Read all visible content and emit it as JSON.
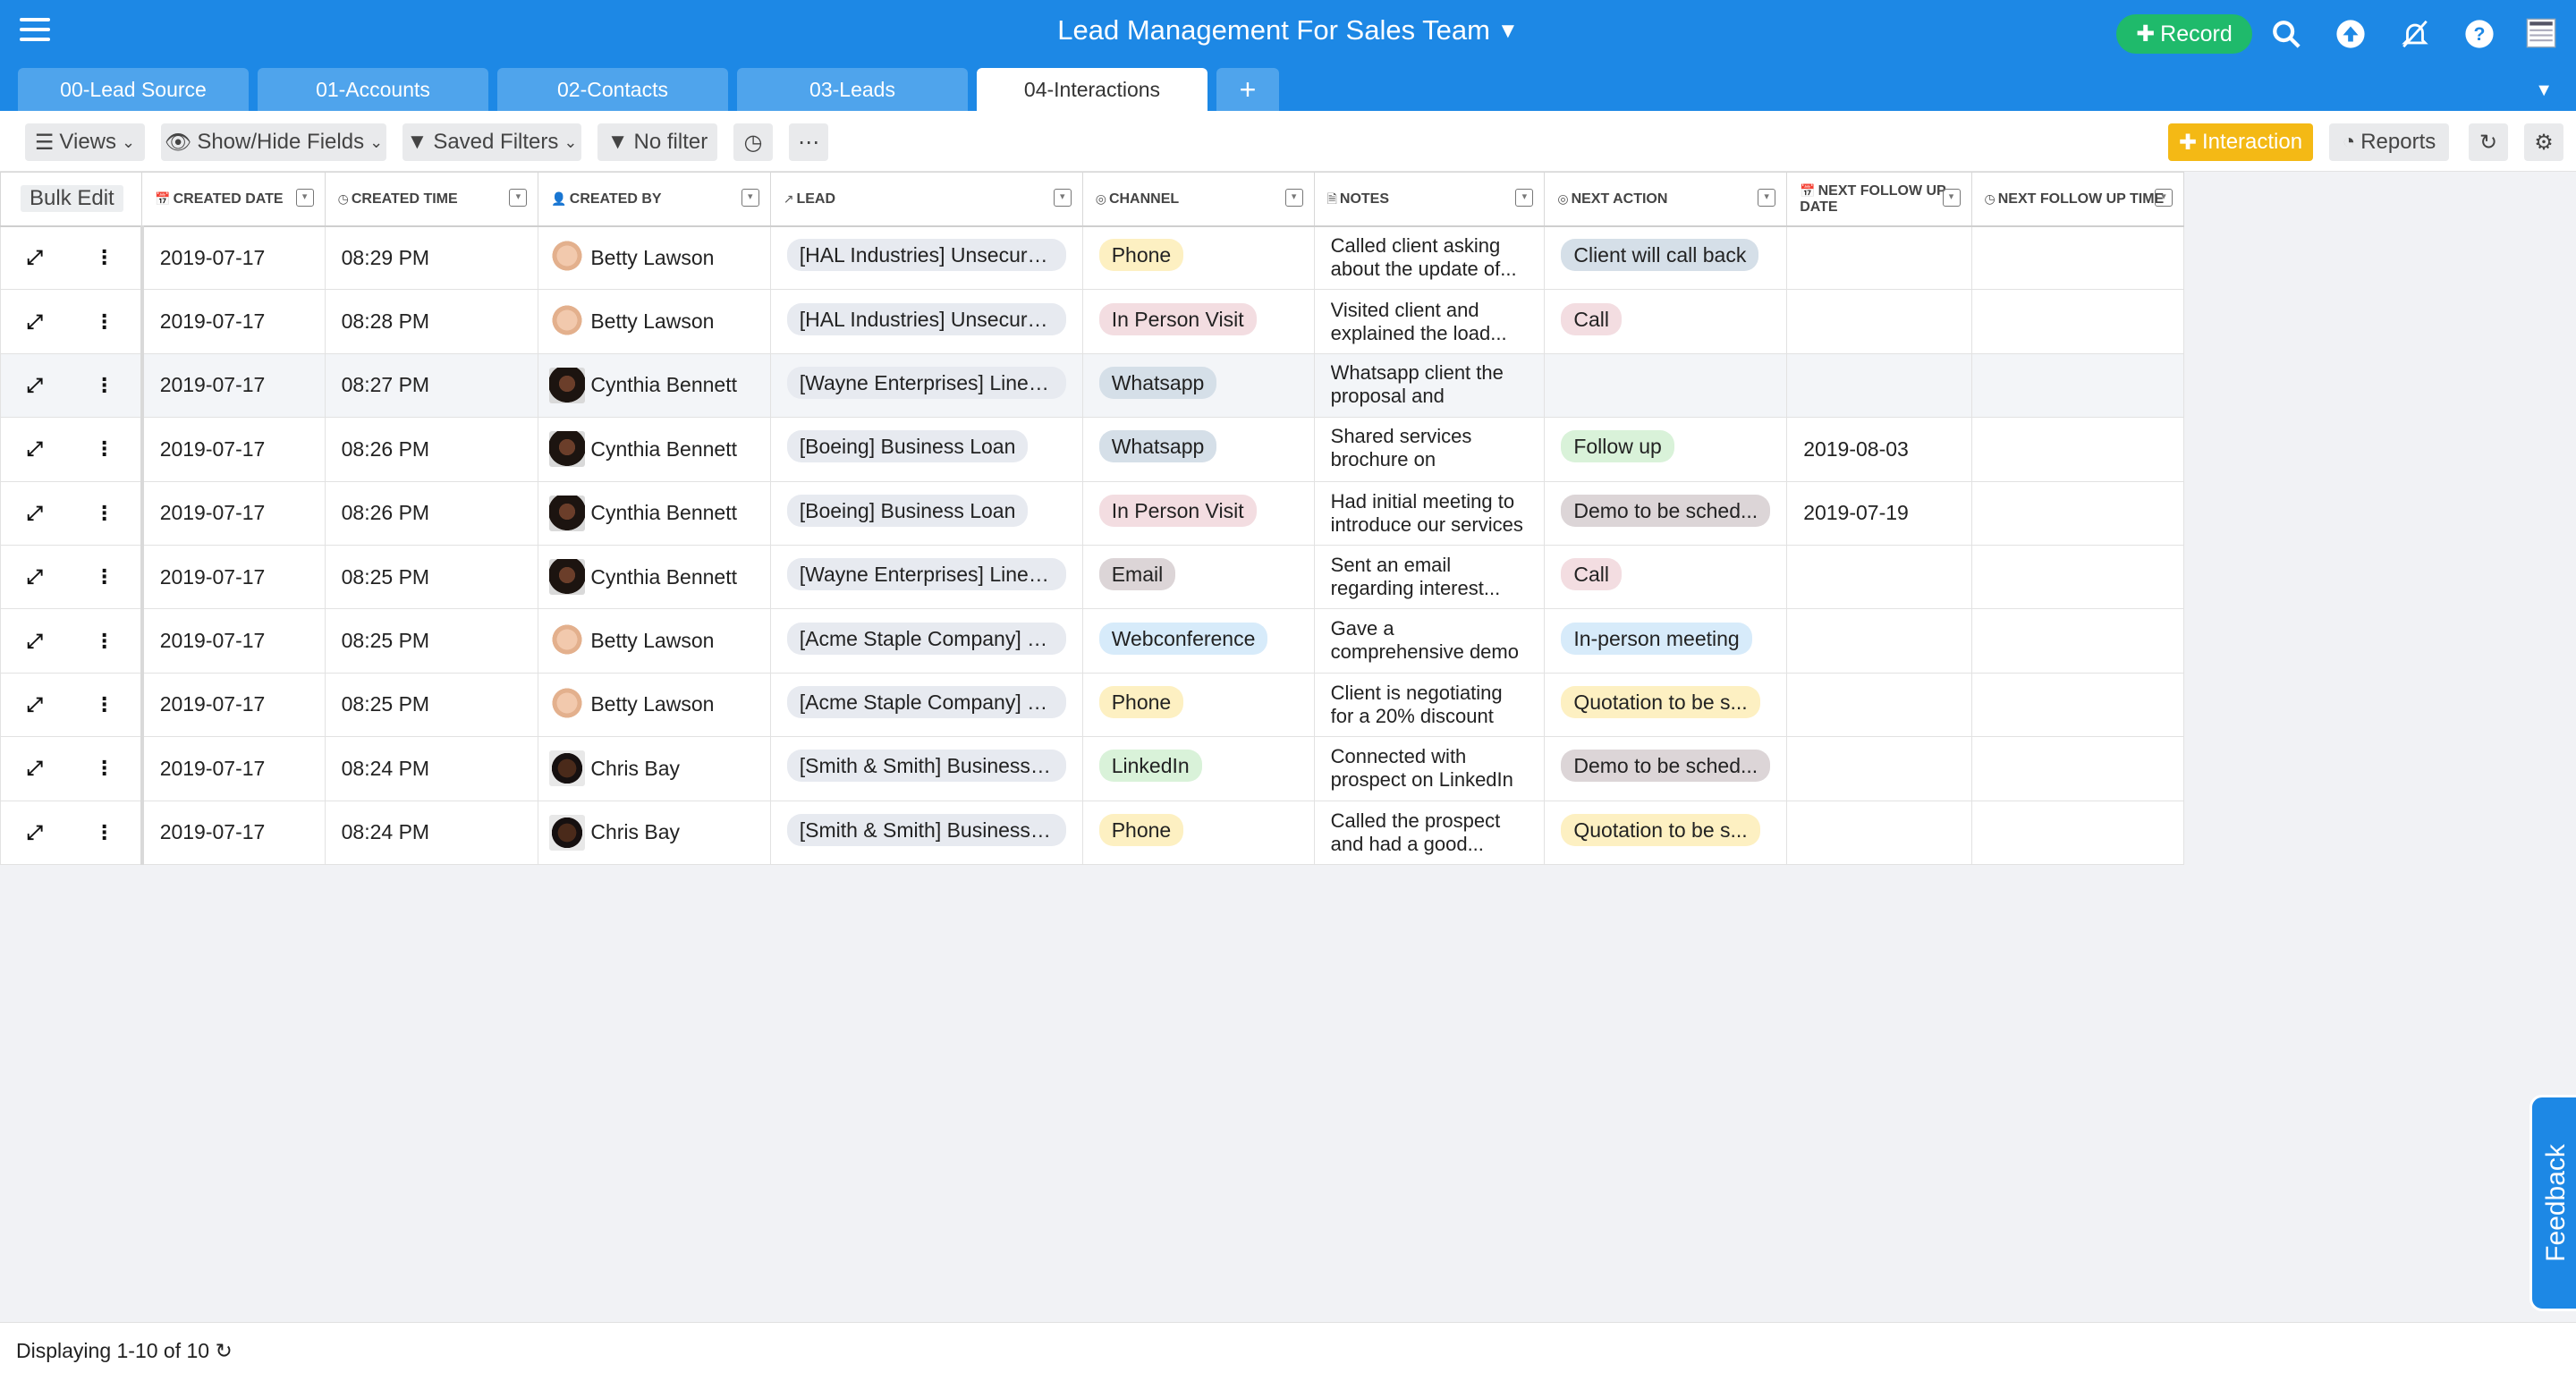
{
  "header": {
    "title": "Lead Management For Sales Team",
    "record_label": "Record"
  },
  "tabs": [
    {
      "label": "00-Lead Source"
    },
    {
      "label": "01-Accounts"
    },
    {
      "label": "02-Contacts"
    },
    {
      "label": "03-Leads"
    },
    {
      "label": "04-Interactions",
      "active": true
    }
  ],
  "toolbar": {
    "views": "Views",
    "show_hide": "Show/Hide Fields",
    "saved_filters": "Saved Filters",
    "no_filter": "No filter",
    "interaction": "Interaction",
    "reports": "Reports"
  },
  "grid": {
    "bulk_edit": "Bulk Edit",
    "columns": [
      {
        "key": "created_date",
        "label": "CREATED DATE",
        "icon": "calendar-icon"
      },
      {
        "key": "created_time",
        "label": "CREATED TIME",
        "icon": "clock-icon"
      },
      {
        "key": "created_by",
        "label": "CREATED BY",
        "icon": "user-icon"
      },
      {
        "key": "lead",
        "label": "LEAD",
        "icon": "link-icon"
      },
      {
        "key": "channel",
        "label": "CHANNEL",
        "icon": "option-icon"
      },
      {
        "key": "notes",
        "label": "NOTES",
        "icon": "notes-icon"
      },
      {
        "key": "next_action",
        "label": "NEXT ACTION",
        "icon": "option-icon"
      },
      {
        "key": "next_follow_up_date",
        "label": "NEXT FOLLOW UP DATE",
        "icon": "calendar-icon"
      },
      {
        "key": "next_follow_up_time",
        "label": "NEXT FOLLOW UP TIME",
        "icon": "clock-icon"
      }
    ],
    "rows": [
      {
        "created_date": "2019-07-17",
        "created_time": "08:29 PM",
        "created_by": "Betty Lawson",
        "avatar": "betty",
        "lead": "[HAL Industries] Unsecure...",
        "channel": "Phone",
        "notes": "Called client asking about the update of...",
        "next_action": "Client will call back",
        "next_follow_up_date": "",
        "next_follow_up_time": ""
      },
      {
        "created_date": "2019-07-17",
        "created_time": "08:28 PM",
        "created_by": "Betty Lawson",
        "avatar": "betty",
        "lead": "[HAL Industries] Unsecure...",
        "channel": "In Person Visit",
        "notes": "Visited client and explained the load...",
        "next_action": "Call",
        "next_follow_up_date": "",
        "next_follow_up_time": ""
      },
      {
        "created_date": "2019-07-17",
        "created_time": "08:27 PM",
        "created_by": "Cynthia Bennett",
        "avatar": "cynthia",
        "lead": "[Wayne Enterprises] Line-o...",
        "channel": "Whatsapp",
        "notes": "Whatsapp client the proposal and interest...",
        "next_action": "",
        "next_follow_up_date": "",
        "next_follow_up_time": ""
      },
      {
        "created_date": "2019-07-17",
        "created_time": "08:26 PM",
        "created_by": "Cynthia Bennett",
        "avatar": "cynthia",
        "lead": "[Boeing] Business Loan",
        "channel": "Whatsapp",
        "notes": "Shared services brochure on Whatsapp",
        "next_action": "Follow up",
        "next_follow_up_date": "2019-08-03",
        "next_follow_up_time": ""
      },
      {
        "created_date": "2019-07-17",
        "created_time": "08:26 PM",
        "created_by": "Cynthia Bennett",
        "avatar": "cynthia",
        "lead": "[Boeing] Business Loan",
        "channel": "In Person Visit",
        "notes": "Had initial meeting to introduce our services",
        "next_action": "Demo to be sched...",
        "next_follow_up_date": "2019-07-19",
        "next_follow_up_time": ""
      },
      {
        "created_date": "2019-07-17",
        "created_time": "08:25 PM",
        "created_by": "Cynthia Bennett",
        "avatar": "cynthia",
        "lead": "[Wayne Enterprises] Line-o...",
        "channel": "Email",
        "notes": "Sent an email regarding interest...",
        "next_action": "Call",
        "next_follow_up_date": "",
        "next_follow_up_time": ""
      },
      {
        "created_date": "2019-07-17",
        "created_time": "08:25 PM",
        "created_by": "Betty Lawson",
        "avatar": "betty",
        "lead": "[Acme Staple Company] Le...",
        "channel": "Webconference",
        "notes": "Gave a comprehensive demo to prospect",
        "next_action": "In-person meeting",
        "next_follow_up_date": "",
        "next_follow_up_time": ""
      },
      {
        "created_date": "2019-07-17",
        "created_time": "08:25 PM",
        "created_by": "Betty Lawson",
        "avatar": "betty",
        "lead": "[Acme Staple Company] Le...",
        "channel": "Phone",
        "notes": "Client is negotiating for a 20% discount",
        "next_action": "Quotation to be s...",
        "next_follow_up_date": "",
        "next_follow_up_time": ""
      },
      {
        "created_date": "2019-07-17",
        "created_time": "08:24 PM",
        "created_by": "Chris Bay",
        "avatar": "chris",
        "lead": "[Smith & Smith] Business L...",
        "channel": "LinkedIn",
        "notes": "Connected with prospect on LinkedIn",
        "next_action": "Demo to be sched...",
        "next_follow_up_date": "",
        "next_follow_up_time": ""
      },
      {
        "created_date": "2019-07-17",
        "created_time": "08:24 PM",
        "created_by": "Chris Bay",
        "avatar": "chris",
        "lead": "[Smith & Smith] Business L...",
        "channel": "Phone",
        "notes": "Called the prospect and had a good...",
        "next_action": "Quotation to be s...",
        "next_follow_up_date": "",
        "next_follow_up_time": ""
      }
    ]
  },
  "colors": {
    "Phone": "#fdf0c2",
    "In Person Visit": "#f3dde1",
    "Whatsapp": "#d5dfe8",
    "Email": "#dcd5d7",
    "Webconference": "#d7ebfa",
    "LinkedIn": "#d9f2d9",
    "Client will call back": "#d5dfe8",
    "Call": "#f3dde1",
    "Follow up": "#d9f2d9",
    "Demo to be sched...": "#dcd5d7",
    "In-person meeting": "#d7ebfa",
    "Quotation to be s...": "#fdf0c2"
  },
  "footer": {
    "status": "Displaying 1-10 of 10"
  },
  "feedback": "Feedback"
}
